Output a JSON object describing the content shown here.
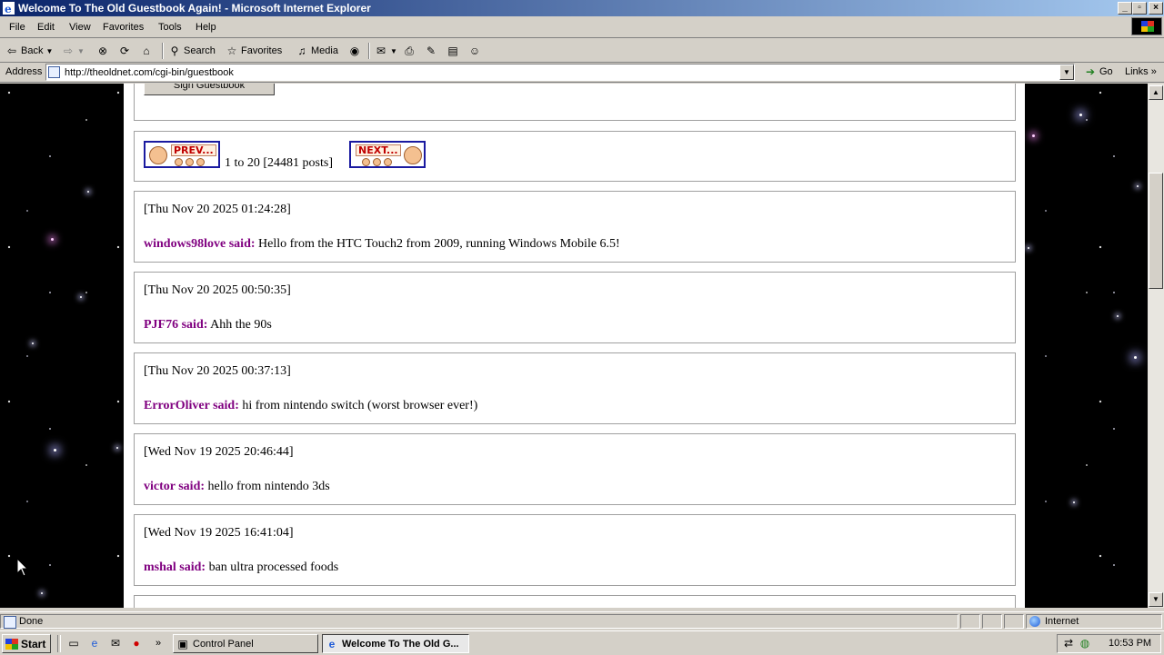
{
  "window": {
    "title": "Welcome To The Old Guestbook Again! - Microsoft Internet Explorer",
    "controls": [
      "minimize",
      "maximize",
      "close"
    ]
  },
  "menu": [
    "File",
    "Edit",
    "View",
    "Favorites",
    "Tools",
    "Help"
  ],
  "toolbar": {
    "back": "Back",
    "search": "Search",
    "favorites": "Favorites",
    "media": "Media"
  },
  "address": {
    "label": "Address",
    "url": "http://theoldnet.com/cgi-bin/guestbook",
    "go": "Go",
    "links": "Links"
  },
  "page": {
    "sign_button_partial": "Sign Guestbook",
    "pagination": {
      "prev_label": "PREV...",
      "next_label": "NEXT...",
      "range_text": "1 to 20 [24481 posts]"
    },
    "posts": [
      {
        "date": "[Thu Nov 20 2025 01:24:28]",
        "author": "windows98love said:",
        "message": "Hello from the HTC Touch2 from 2009, running Windows Mobile 6.5!"
      },
      {
        "date": "[Thu Nov 20 2025 00:50:35]",
        "author": "PJF76 said:",
        "message": "Ahh the 90s"
      },
      {
        "date": "[Thu Nov 20 2025 00:37:13]",
        "author": "ErrorOliver said:",
        "message": "hi from nintendo switch (worst browser ever!)"
      },
      {
        "date": "[Wed Nov 19 2025 20:46:44]",
        "author": "victor said:",
        "message": "hello from nintendo 3ds"
      },
      {
        "date": "[Wed Nov 19 2025 16:41:04]",
        "author": "mshal said:",
        "message": "ban ultra processed foods"
      }
    ]
  },
  "status": {
    "text": "Done",
    "zone": "Internet"
  },
  "taskbar": {
    "start": "Start",
    "tasks": [
      {
        "label": "Control Panel",
        "active": false
      },
      {
        "label": "Welcome To The Old G...",
        "active": true
      }
    ],
    "clock": "10:53 PM"
  }
}
